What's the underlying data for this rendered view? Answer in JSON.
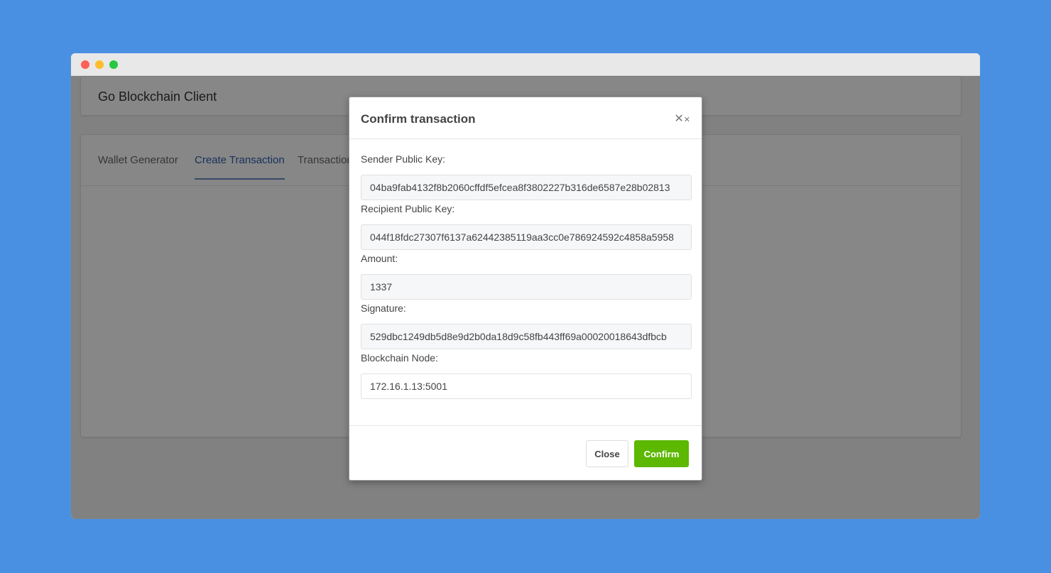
{
  "window": {
    "controls": [
      "close",
      "minimize",
      "maximize"
    ]
  },
  "app": {
    "title": "Go Blockchain Client"
  },
  "tabs": [
    {
      "label": "Wallet Generator",
      "active": false
    },
    {
      "label": "Create Transaction",
      "active": true
    },
    {
      "label": "Transactions",
      "active": false
    }
  ],
  "modal": {
    "title": "Confirm transaction",
    "close_icon": "close-x-icon",
    "fields": [
      {
        "label": "Sender Public Key:",
        "value": "04ba9fab4132f8b2060cffdf5efcea8f3802227b316de6587e28b02813"
      },
      {
        "label": "Recipient Public Key:",
        "value": "044f18fdc27307f6137a62442385119aa3cc0e786924592c4858a5958"
      },
      {
        "label": "Amount:",
        "value": "1337"
      },
      {
        "label": "Signature:",
        "value": "529dbc1249db5d8e9d2b0da18d9c58fb443ff69a00020018643dfbcb"
      },
      {
        "label": "Blockchain Node:",
        "value": "172.16.1.13:5001"
      }
    ],
    "close_label": "Close",
    "confirm_label": "Confirm"
  },
  "colors": {
    "background": "#4a90e2",
    "confirm": "#5cb800",
    "active_tab": "#2d5eaa"
  }
}
